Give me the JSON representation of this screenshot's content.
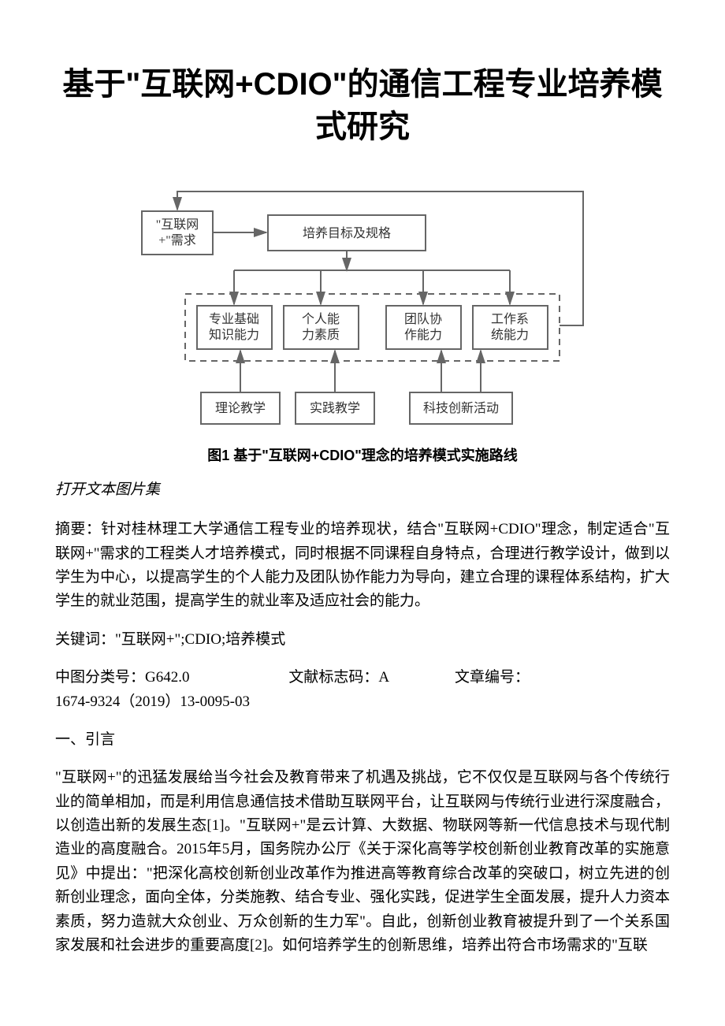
{
  "title": "基于\"互联网+CDIO\"的通信工程专业培养模式研究",
  "figure": {
    "box_top_left": "\"互联网+\"需求",
    "box_top_right": "培养目标及规格",
    "mid1": "专业基础知识能力",
    "mid2": "个人能力素质",
    "mid3": "团队协作能力",
    "mid4": "工作系统能力",
    "bot1": "理论教学",
    "bot2": "实践教学",
    "bot3": "科技创新活动",
    "caption": "图1  基于\"互联网+CDIO\"理念的培养模式实施路线"
  },
  "open_gallery": "打开文本图片集",
  "abstract_label": "摘要：",
  "abstract": "针对桂林理工大学通信工程专业的培养现状，结合\"互联网+CDIO\"理念，制定适合\"互联网+\"需求的工程类人才培养模式，同时根据不同课程自身特点，合理进行教学设计，做到以学生为中心，以提高学生的个人能力及团队协作能力为导向，建立合理的课程体系结构，扩大学生的就业范围，提高学生的就业率及适应社会的能力。",
  "keywords_label": "关键词：",
  "keywords": "\"互联网+\";CDIO;培养模式",
  "meta": {
    "clc_label": "中图分类号：",
    "clc": "G642.0",
    "doc_code_label": "文献标志码：",
    "doc_code": "A",
    "article_no_label": "文章编号：",
    "article_no": "1674-9324（2019）13-0095-03"
  },
  "section1": "一、引言",
  "body1": "\"互联网+\"的迅猛发展给当今社会及教育带来了机遇及挑战，它不仅仅是互联网与各个传统行业的简单相加，而是利用信息通信技术借助互联网平台，让互联网与传统行业进行深度融合，以创造出新的发展生态[1]。\"互联网+\"是云计算、大数据、物联网等新一代信息技术与现代制造业的高度融合。2015年5月，国务院办公厅《关于深化高等学校创新创业教育改革的实施意见》中提出：\"把深化高校创新创业改革作为推进高等教育综合改革的突破口，树立先进的创新创业理念，面向全体，分类施教、结合专业、强化实践，促进学生全面发展，提升人力资本素质，努力造就大众创业、万众创新的生力军\"。自此，创新创业教育被提升到了一个关系国家发展和社会进步的重要高度[2]。如何培养学生的创新思维，培养出符合市场需求的\"互联"
}
